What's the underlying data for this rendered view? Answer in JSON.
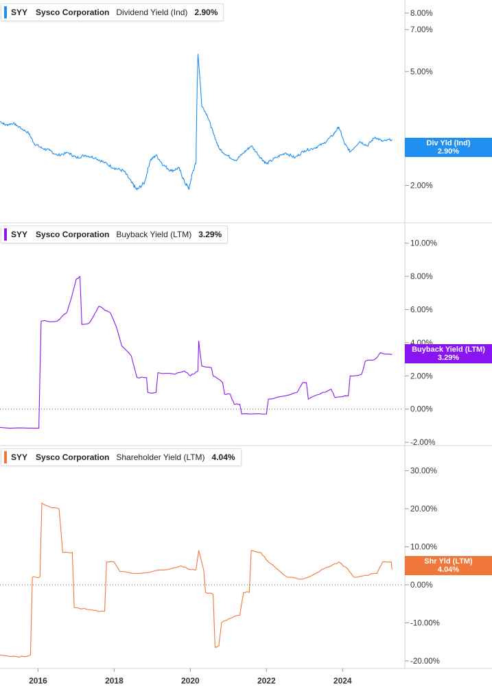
{
  "colors": {
    "dividend": "#1f8ff0",
    "buyback": "#8a14f2",
    "shareholder": "#f0773a",
    "grid": "#e6e6e6",
    "axis_text": "#333333"
  },
  "chart_data": [
    {
      "type": "line",
      "legend": {
        "ticker": "SYY",
        "company": "Sysco Corporation",
        "metric": "Dividend Yield (Ind)",
        "value": "2.90%"
      },
      "tag": {
        "label": "Div Yld (Ind)",
        "value": "2.90%"
      },
      "scale": "log",
      "ylim": [
        1.7,
        8.5
      ],
      "y_ticks": [
        {
          "v": 8,
          "label": "8.00%"
        },
        {
          "v": 7,
          "label": "7.00%"
        },
        {
          "v": 5,
          "label": "5.00%"
        },
        {
          "v": 2,
          "label": "2.00%"
        }
      ],
      "zero_line": false,
      "series": [
        {
          "values": [
            [
              2015.0,
              3.35
            ],
            [
              2015.15,
              3.25
            ],
            [
              2015.35,
              3.3
            ],
            [
              2015.5,
              3.2
            ],
            [
              2015.75,
              3.05
            ],
            [
              2015.9,
              2.8
            ],
            [
              2016.1,
              2.7
            ],
            [
              2016.3,
              2.65
            ],
            [
              2016.5,
              2.55
            ],
            [
              2016.8,
              2.6
            ],
            [
              2017.0,
              2.5
            ],
            [
              2017.25,
              2.55
            ],
            [
              2017.5,
              2.5
            ],
            [
              2017.75,
              2.4
            ],
            [
              2018.0,
              2.3
            ],
            [
              2018.25,
              2.25
            ],
            [
              2018.45,
              2.05
            ],
            [
              2018.6,
              1.93
            ],
            [
              2018.8,
              2.05
            ],
            [
              2018.95,
              2.45
            ],
            [
              2019.1,
              2.55
            ],
            [
              2019.3,
              2.35
            ],
            [
              2019.5,
              2.25
            ],
            [
              2019.7,
              2.3
            ],
            [
              2019.85,
              2.05
            ],
            [
              2019.97,
              1.95
            ],
            [
              2020.05,
              2.2
            ],
            [
              2020.15,
              2.4
            ],
            [
              2020.2,
              5.75
            ],
            [
              2020.3,
              3.8
            ],
            [
              2020.45,
              3.5
            ],
            [
              2020.6,
              3.05
            ],
            [
              2020.75,
              2.7
            ],
            [
              2020.95,
              2.55
            ],
            [
              2021.2,
              2.45
            ],
            [
              2021.4,
              2.6
            ],
            [
              2021.6,
              2.75
            ],
            [
              2021.85,
              2.5
            ],
            [
              2022.0,
              2.38
            ],
            [
              2022.25,
              2.5
            ],
            [
              2022.5,
              2.6
            ],
            [
              2022.75,
              2.5
            ],
            [
              2023.0,
              2.65
            ],
            [
              2023.25,
              2.7
            ],
            [
              2023.5,
              2.8
            ],
            [
              2023.75,
              3.0
            ],
            [
              2023.9,
              3.2
            ],
            [
              2024.05,
              2.8
            ],
            [
              2024.2,
              2.62
            ],
            [
              2024.45,
              2.85
            ],
            [
              2024.65,
              2.75
            ],
            [
              2024.85,
              2.95
            ],
            [
              2025.05,
              2.85
            ],
            [
              2025.3,
              2.9
            ]
          ]
        }
      ]
    },
    {
      "type": "line",
      "legend": {
        "ticker": "SYY",
        "company": "Sysco Corporation",
        "metric": "Buyback Yield (LTM)",
        "value": "3.29%"
      },
      "tag": {
        "label": "Buyback Yield (LTM)",
        "value": "3.29%"
      },
      "scale": "linear",
      "ylim": [
        -2.2,
        10.4
      ],
      "y_ticks": [
        {
          "v": 10,
          "label": "10.00%"
        },
        {
          "v": 8,
          "label": "8.00%"
        },
        {
          "v": 6,
          "label": "6.00%"
        },
        {
          "v": 4,
          "label": "4.00%"
        },
        {
          "v": 2,
          "label": "2.00%"
        },
        {
          "v": 0,
          "label": "0.00%"
        },
        {
          "v": -2,
          "label": "-2.00%"
        }
      ],
      "zero_line": true,
      "series": [
        {
          "values": [
            [
              2015.0,
              -1.1
            ],
            [
              2016.02,
              -1.15
            ],
            [
              2016.08,
              5.3
            ],
            [
              2016.5,
              5.3
            ],
            [
              2016.75,
              5.8
            ],
            [
              2016.85,
              6.5
            ],
            [
              2017.0,
              7.8
            ],
            [
              2017.1,
              8.0
            ],
            [
              2017.15,
              5.1
            ],
            [
              2017.35,
              5.2
            ],
            [
              2017.5,
              5.8
            ],
            [
              2017.6,
              6.2
            ],
            [
              2017.9,
              5.8
            ],
            [
              2018.05,
              5.0
            ],
            [
              2018.2,
              3.8
            ],
            [
              2018.45,
              3.2
            ],
            [
              2018.6,
              1.9
            ],
            [
              2018.85,
              1.9
            ],
            [
              2018.88,
              1.0
            ],
            [
              2019.1,
              1.0
            ],
            [
              2019.15,
              2.2
            ],
            [
              2019.6,
              2.1
            ],
            [
              2019.85,
              2.3
            ],
            [
              2020.0,
              2.0
            ],
            [
              2020.2,
              2.3
            ],
            [
              2020.22,
              4.1
            ],
            [
              2020.3,
              2.6
            ],
            [
              2020.55,
              2.5
            ],
            [
              2020.6,
              2.0
            ],
            [
              2020.85,
              1.6
            ],
            [
              2020.9,
              0.9
            ],
            [
              2021.05,
              0.9
            ],
            [
              2021.15,
              0.3
            ],
            [
              2021.3,
              0.3
            ],
            [
              2021.35,
              -0.3
            ],
            [
              2021.6,
              -0.3
            ],
            [
              2022.0,
              -0.3
            ],
            [
              2022.05,
              0.6
            ],
            [
              2022.5,
              0.8
            ],
            [
              2022.8,
              1.0
            ],
            [
              2022.95,
              1.6
            ],
            [
              2023.05,
              1.6
            ],
            [
              2023.1,
              0.6
            ],
            [
              2023.4,
              0.9
            ],
            [
              2023.7,
              1.2
            ],
            [
              2023.8,
              0.7
            ],
            [
              2024.15,
              0.8
            ],
            [
              2024.2,
              2.0
            ],
            [
              2024.5,
              2.1
            ],
            [
              2024.6,
              2.9
            ],
            [
              2024.85,
              3.0
            ],
            [
              2025.0,
              3.4
            ],
            [
              2025.3,
              3.29
            ]
          ]
        }
      ]
    },
    {
      "type": "line",
      "legend": {
        "ticker": "SYY",
        "company": "Sysco Corporation",
        "metric": "Shareholder Yield (LTM)",
        "value": "4.04%"
      },
      "tag": {
        "label": "Shr Yld (LTM)",
        "value": "4.04%"
      },
      "scale": "linear",
      "ylim": [
        -22,
        33
      ],
      "y_ticks": [
        {
          "v": 30,
          "label": "30.00%"
        },
        {
          "v": 20,
          "label": "20.00%"
        },
        {
          "v": 10,
          "label": "10.00%"
        },
        {
          "v": 0,
          "label": "0.00%"
        },
        {
          "v": -10,
          "label": "-10.00%"
        },
        {
          "v": -20,
          "label": "-20.00%"
        }
      ],
      "zero_line": true,
      "series": [
        {
          "values": [
            [
              2015.0,
              -18.5
            ],
            [
              2015.5,
              -19.0
            ],
            [
              2015.8,
              -18.5
            ],
            [
              2015.85,
              2.0
            ],
            [
              2016.05,
              2.0
            ],
            [
              2016.1,
              21.5
            ],
            [
              2016.3,
              20.5
            ],
            [
              2016.55,
              20.0
            ],
            [
              2016.65,
              8.5
            ],
            [
              2016.9,
              8.5
            ],
            [
              2016.95,
              -6.0
            ],
            [
              2017.3,
              -6.5
            ],
            [
              2017.6,
              -7.0
            ],
            [
              2017.75,
              -7.0
            ],
            [
              2017.8,
              6.0
            ],
            [
              2018.0,
              6.0
            ],
            [
              2018.15,
              3.5
            ],
            [
              2018.6,
              3.0
            ],
            [
              2019.0,
              3.5
            ],
            [
              2019.4,
              4.0
            ],
            [
              2019.75,
              5.0
            ],
            [
              2020.0,
              4.0
            ],
            [
              2020.15,
              4.0
            ],
            [
              2020.22,
              9.0
            ],
            [
              2020.35,
              4.0
            ],
            [
              2020.4,
              -2.0
            ],
            [
              2020.6,
              -2.5
            ],
            [
              2020.65,
              -16.5
            ],
            [
              2020.75,
              -16.0
            ],
            [
              2020.82,
              -10.0
            ],
            [
              2021.0,
              -9.0
            ],
            [
              2021.3,
              -8.0
            ],
            [
              2021.4,
              -2.0
            ],
            [
              2021.55,
              -2.0
            ],
            [
              2021.6,
              9.0
            ],
            [
              2021.85,
              8.5
            ],
            [
              2022.05,
              6.0
            ],
            [
              2022.3,
              4.0
            ],
            [
              2022.55,
              2.0
            ],
            [
              2022.95,
              1.5
            ],
            [
              2023.2,
              2.5
            ],
            [
              2023.45,
              4.0
            ],
            [
              2023.7,
              5.0
            ],
            [
              2023.9,
              6.0
            ],
            [
              2024.15,
              4.0
            ],
            [
              2024.3,
              2.0
            ],
            [
              2024.6,
              2.5
            ],
            [
              2024.9,
              3.0
            ],
            [
              2025.05,
              6.0
            ],
            [
              2025.28,
              6.0
            ],
            [
              2025.3,
              4.04
            ]
          ]
        }
      ]
    }
  ],
  "x_axis": {
    "range": [
      2015.0,
      2025.6
    ],
    "ticks": [
      {
        "v": 2016,
        "label": "2016"
      },
      {
        "v": 2018,
        "label": "2018"
      },
      {
        "v": 2020,
        "label": "2020"
      },
      {
        "v": 2022,
        "label": "2022"
      },
      {
        "v": 2024,
        "label": "2024"
      }
    ]
  }
}
